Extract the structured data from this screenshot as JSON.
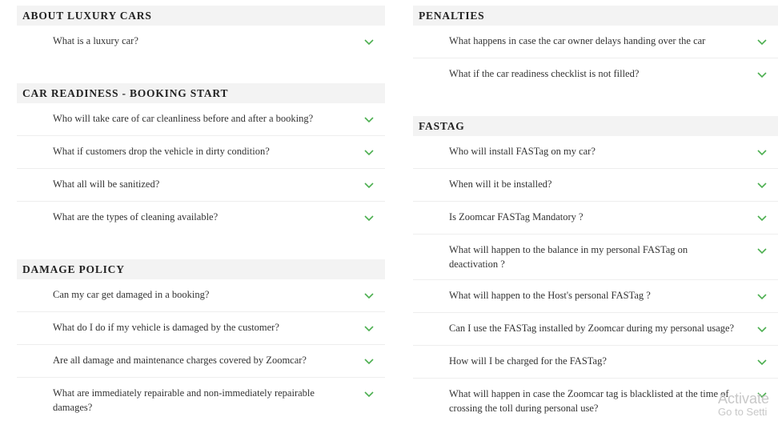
{
  "accent_color": "#4caf50",
  "left_column": [
    {
      "title": "ABOUT LUXURY CARS",
      "questions": [
        "What is a luxury car?"
      ]
    },
    {
      "title": "CAR READINESS - BOOKING START",
      "questions": [
        "Who will take care of car cleanliness before and after a booking?",
        "What if customers drop the vehicle in dirty condition?",
        "What all will be sanitized?",
        "What are the types of cleaning available?"
      ]
    },
    {
      "title": "DAMAGE POLICY",
      "questions": [
        "Can my car get damaged in a booking?",
        "What do I do if my vehicle is damaged by the customer?",
        "Are all damage and maintenance charges covered by Zoomcar?",
        "What are immediately repairable and non-immediately repairable damages?"
      ]
    }
  ],
  "right_column": [
    {
      "title": "PENALTIES",
      "questions": [
        "What happens in case the car owner delays handing over the car",
        "What if the car readiness checklist is not filled?"
      ]
    },
    {
      "title": "FASTAG",
      "questions": [
        "Who will install FASTag on my car?",
        "When will it be installed?",
        "Is Zoomcar FASTag Mandatory ?",
        "What will happen to the balance in my personal FASTag on deactivation ?",
        "What will happen to the Host's personal FASTag ?",
        "Can I use the FASTag installed by Zoomcar during my personal usage?",
        "How will I be charged for the FASTag?",
        "What will happen in case the Zoomcar tag is blacklisted at the time of crossing the toll during personal use?"
      ]
    }
  ],
  "watermark": {
    "title": "Activate",
    "subtitle": "Go to Setti"
  }
}
